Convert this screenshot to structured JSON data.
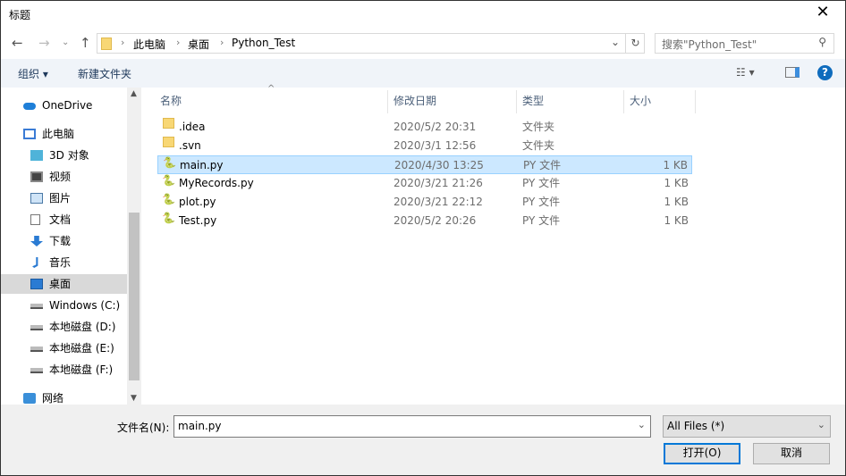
{
  "window": {
    "title": "标题",
    "close_icon": "close-icon"
  },
  "nav": {
    "breadcrumb": [
      "此电脑",
      "桌面",
      "Python_Test"
    ],
    "search_placeholder": "搜索\"Python_Test\""
  },
  "toolbar": {
    "organize": "组织",
    "new_folder": "新建文件夹"
  },
  "sidebar": {
    "items": [
      {
        "label": "OneDrive",
        "icon": "cloud-icon"
      },
      {
        "label": "此电脑",
        "icon": "computer-icon"
      },
      {
        "label": "3D 对象",
        "icon": "cube-icon"
      },
      {
        "label": "视频",
        "icon": "video-icon"
      },
      {
        "label": "图片",
        "icon": "picture-icon"
      },
      {
        "label": "文档",
        "icon": "document-icon"
      },
      {
        "label": "下载",
        "icon": "download-icon"
      },
      {
        "label": "音乐",
        "icon": "music-icon"
      },
      {
        "label": "桌面",
        "icon": "desktop-icon",
        "selected": true
      },
      {
        "label": "Windows (C:)",
        "icon": "drive-icon"
      },
      {
        "label": "本地磁盘 (D:)",
        "icon": "drive-icon"
      },
      {
        "label": "本地磁盘 (E:)",
        "icon": "drive-icon"
      },
      {
        "label": "本地磁盘 (F:)",
        "icon": "drive-icon"
      },
      {
        "label": "网络",
        "icon": "network-icon"
      }
    ]
  },
  "columns": {
    "name": "名称",
    "date": "修改日期",
    "type": "类型",
    "size": "大小"
  },
  "files": [
    {
      "name": ".idea",
      "date": "2020/5/2 20:31",
      "type": "文件夹",
      "size": ""
    },
    {
      "name": ".svn",
      "date": "2020/3/1 12:56",
      "type": "文件夹",
      "size": ""
    },
    {
      "name": "main.py",
      "date": "2020/4/30 13:25",
      "type": "PY 文件",
      "size": "1 KB",
      "selected": true
    },
    {
      "name": "MyRecords.py",
      "date": "2020/3/21 21:26",
      "type": "PY 文件",
      "size": "1 KB"
    },
    {
      "name": "plot.py",
      "date": "2020/3/21 22:12",
      "type": "PY 文件",
      "size": "1 KB"
    },
    {
      "name": "Test.py",
      "date": "2020/5/2 20:26",
      "type": "PY 文件",
      "size": "1 KB"
    }
  ],
  "bottom": {
    "filename_label": "文件名(N):",
    "filename_value": "main.py",
    "filetype": "All Files  (*)",
    "open": "打开(O)",
    "cancel": "取消"
  }
}
